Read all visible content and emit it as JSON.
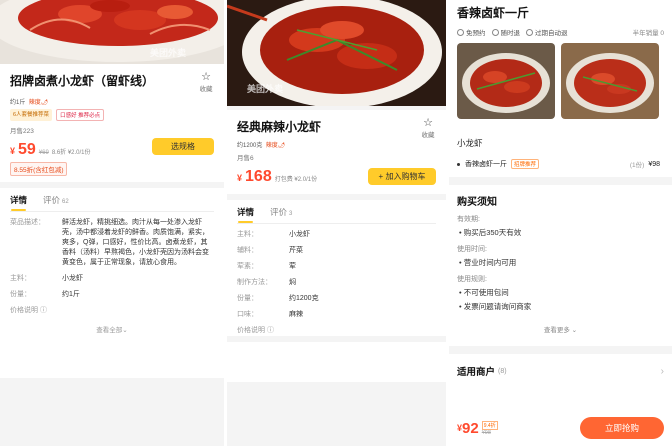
{
  "panel1": {
    "title": "招牌卤煮小龙虾（留虾线）",
    "fav_label": "收藏",
    "weight": "约1斤",
    "spicy": "辣度🌶",
    "tag1": "6人套餐推荐菜",
    "tag2": "口感好 推荐必点",
    "sold": "月售223",
    "currency": "¥",
    "price": "59",
    "orig_price": "¥69",
    "discount": "8.6折 ¥2.0/1份",
    "select_btn": "选规格",
    "coupon": "8.55折(含红包减)",
    "tabs": [
      {
        "label": "详情"
      },
      {
        "label": "评价",
        "count": "62"
      }
    ],
    "details": [
      {
        "k": "菜品描述：",
        "v": "鲜活龙虾，精挑细选。肉汁从每一处渗入龙虾壳，汤中都浸着龙虾的鲜香。肉质饱满，紧实，爽多，Q弹，口感好，性价比高。卤煮龙虾，其香料（汤料）早熬褐色，小龙虾壳因为汤料会变黄变色，属于正常现象，请放心食用。"
      },
      {
        "k": "主料：",
        "v": "小龙虾"
      },
      {
        "k": "份量：",
        "v": "约1斤"
      }
    ],
    "price_note": "价格说明 ⓘ",
    "see_all": "查看全部⌄"
  },
  "panel2": {
    "title": "经典麻辣小龙虾",
    "fav_label": "收藏",
    "weight": "约1200克",
    "spicy": "辣度🌶",
    "sold": "月售6",
    "currency": "¥",
    "price": "168",
    "discount": "打包费 ¥2.0/1份",
    "add_btn": "+ 加入购物车",
    "tabs": [
      {
        "label": "详情"
      },
      {
        "label": "评价",
        "count": "3"
      }
    ],
    "details": [
      {
        "k": "主料：",
        "v": "小龙虾"
      },
      {
        "k": "辅料：",
        "v": "芹菜"
      },
      {
        "k": "荤素：",
        "v": "荤"
      },
      {
        "k": "制作方法：",
        "v": "焖"
      },
      {
        "k": "份量：",
        "v": "约1200克"
      },
      {
        "k": "口味：",
        "v": "麻辣"
      }
    ],
    "price_note": "价格说明 ⓘ"
  },
  "panel3": {
    "title": "香辣卤虾一斤",
    "chips": [
      "免预约",
      "随时退",
      "过期自动退"
    ],
    "sales": "半年销量 0",
    "pkg_title": "小龙虾",
    "pkg_item": "香辣卤虾一斤",
    "pkg_tag": "招牌推荐",
    "pkg_qty": "(1份)",
    "pkg_price": "¥98",
    "buy_title": "购买须知",
    "rules": [
      {
        "k": "有效期:",
        "v": "购买后350天有效"
      },
      {
        "k": "使用时间:",
        "v": "营业时间内可用"
      },
      {
        "k": "使用规则:",
        "v": "不可使用包间"
      },
      {
        "k": "",
        "v": "发票问题请询问商家"
      }
    ],
    "see_more": "查看更多 ⌄",
    "merchant_title": "适用商户",
    "merchant_count": "(8)",
    "currency": "¥",
    "price": "92",
    "disc_badge": "9.4折",
    "orig_price": "¥98",
    "buy_btn": "立即抢购"
  },
  "watermark": "美团外卖",
  "colors": {
    "accent_yellow": "#ffcb2a",
    "price_red": "#ff4a2e",
    "buy_orange": "#ff6633"
  }
}
